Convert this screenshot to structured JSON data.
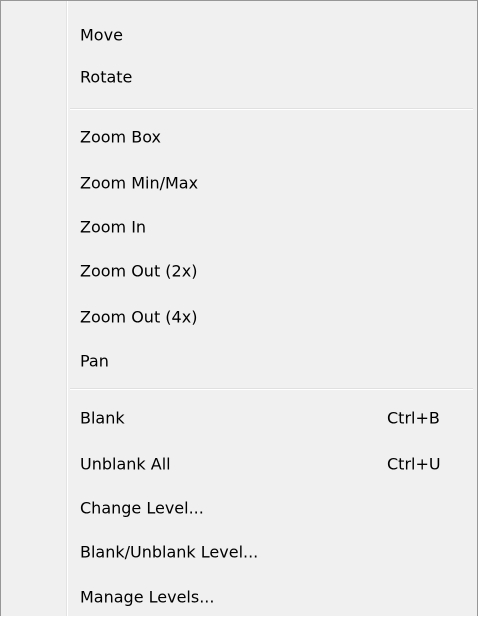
{
  "menu": {
    "groups": [
      {
        "items": [
          {
            "label": "Move",
            "shortcut": ""
          },
          {
            "label": "Rotate",
            "shortcut": ""
          }
        ]
      },
      {
        "items": [
          {
            "label": "Zoom Box",
            "shortcut": ""
          },
          {
            "label": "Zoom Min/Max",
            "shortcut": ""
          },
          {
            "label": "Zoom In",
            "shortcut": ""
          },
          {
            "label": "Zoom Out (2x)",
            "shortcut": ""
          },
          {
            "label": "Zoom Out (4x)",
            "shortcut": ""
          },
          {
            "label": "Pan",
            "shortcut": ""
          }
        ]
      },
      {
        "items": [
          {
            "label": "Blank",
            "shortcut": "Ctrl+B"
          },
          {
            "label": "Unblank All",
            "shortcut": "Ctrl+U"
          },
          {
            "label": "Change Level...",
            "shortcut": ""
          },
          {
            "label": "Blank/Unblank Level...",
            "shortcut": ""
          },
          {
            "label": "Manage Levels...",
            "shortcut": ""
          }
        ]
      }
    ]
  },
  "colors": {
    "menu_background": "#f0f0f0",
    "border": "#979797",
    "separator": "#e0e0e0",
    "text": "#000000"
  }
}
